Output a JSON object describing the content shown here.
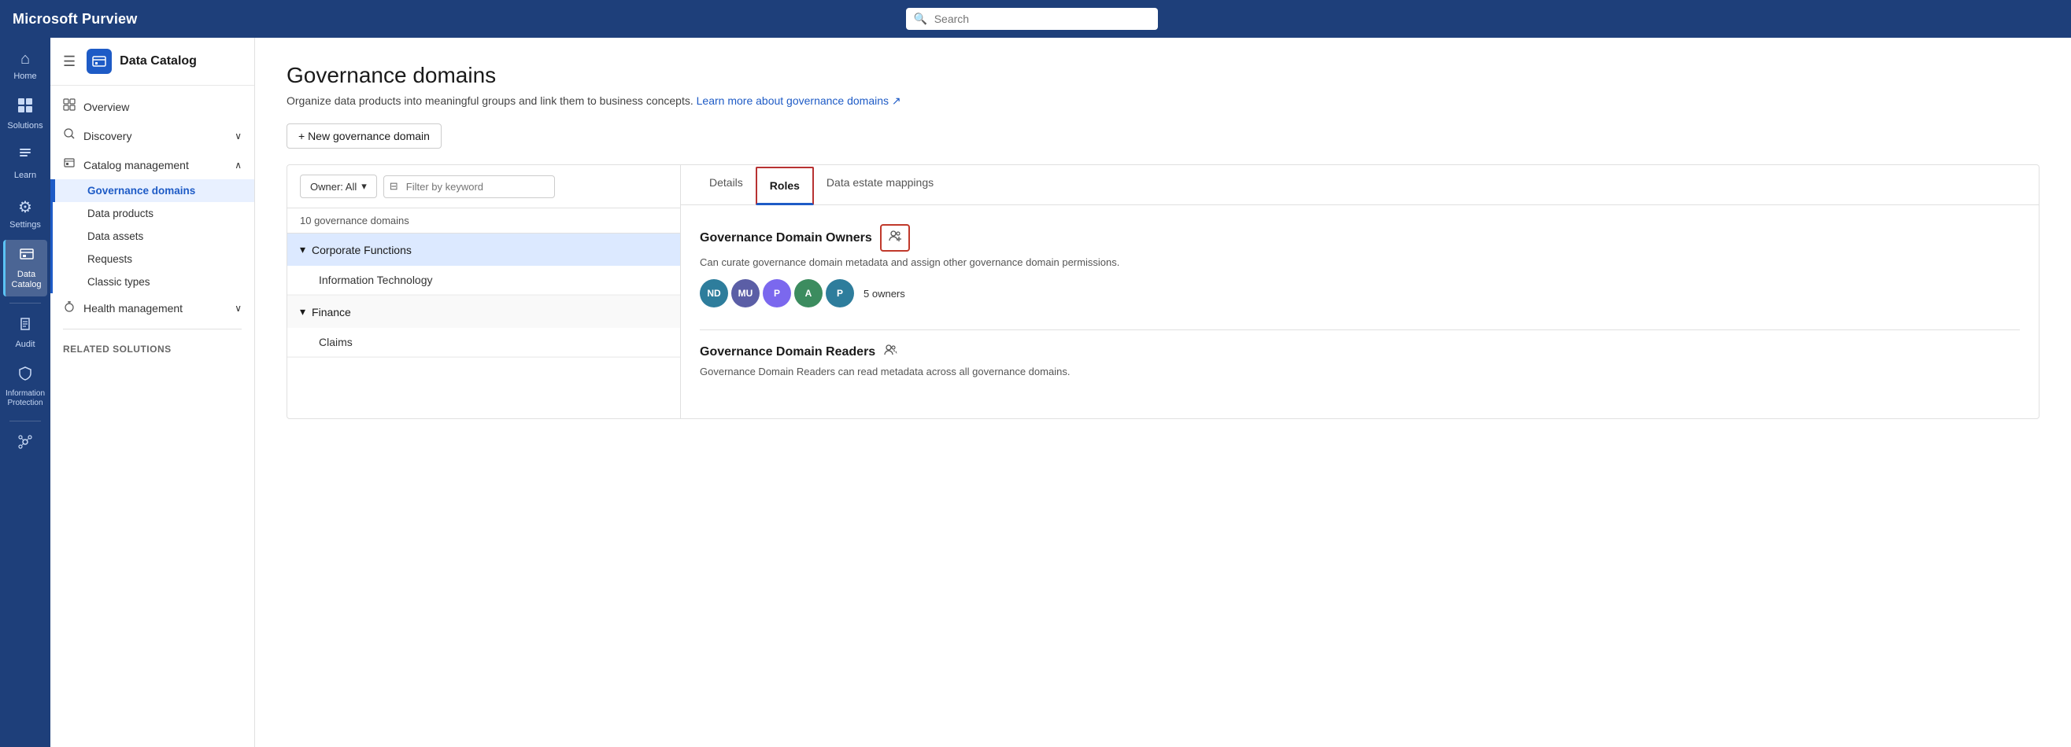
{
  "topbar": {
    "logo": "Microsoft Purview",
    "search_placeholder": "Search"
  },
  "icon_nav": {
    "items": [
      {
        "id": "home",
        "icon": "⌂",
        "label": "Home"
      },
      {
        "id": "solutions",
        "icon": "⊞",
        "label": "Solutions"
      },
      {
        "id": "learn",
        "icon": "📖",
        "label": "Learn"
      },
      {
        "id": "settings",
        "icon": "⚙",
        "label": "Settings"
      },
      {
        "id": "data-catalog",
        "icon": "🗄",
        "label": "Data Catalog",
        "active": true
      },
      {
        "id": "audit",
        "icon": "📋",
        "label": "Audit"
      },
      {
        "id": "info-protection",
        "icon": "🔒",
        "label": "Information Protection"
      }
    ]
  },
  "sidebar": {
    "header_title": "Data Catalog",
    "nav_items": [
      {
        "id": "overview",
        "label": "Overview",
        "icon": "⊞",
        "type": "item"
      },
      {
        "id": "discovery",
        "label": "Discovery",
        "icon": "🔍",
        "type": "expandable",
        "expanded": true
      },
      {
        "id": "catalog-management",
        "label": "Catalog management",
        "icon": "📁",
        "type": "expandable",
        "expanded": true
      },
      {
        "id": "governance-domains",
        "label": "Governance domains",
        "type": "subitem",
        "active": true
      },
      {
        "id": "data-products",
        "label": "Data products",
        "type": "subitem"
      },
      {
        "id": "data-assets",
        "label": "Data assets",
        "type": "subitem"
      },
      {
        "id": "requests",
        "label": "Requests",
        "type": "subitem"
      },
      {
        "id": "classic-types",
        "label": "Classic types",
        "type": "subitem"
      },
      {
        "id": "health-management",
        "label": "Health management",
        "icon": "💊",
        "type": "expandable"
      }
    ],
    "related_label": "Related solutions"
  },
  "page": {
    "title": "Governance domains",
    "subtitle": "Organize data products into meaningful groups and link them to business concepts.",
    "learn_link": "Learn more about governance domains ↗",
    "new_btn": "+ New governance domain"
  },
  "domain_list": {
    "owner_filter": "Owner: All",
    "filter_placeholder": "Filter by keyword",
    "filter_icon": "⊟",
    "count_label": "10 governance domains",
    "domains": [
      {
        "id": "corporate-functions",
        "label": "Corporate Functions",
        "expanded": true,
        "children": [
          {
            "id": "information-technology",
            "label": "Information Technology"
          }
        ]
      },
      {
        "id": "finance",
        "label": "Finance",
        "expanded": true,
        "children": [
          {
            "id": "claims",
            "label": "Claims"
          }
        ]
      }
    ]
  },
  "details_panel": {
    "tabs": [
      {
        "id": "details",
        "label": "Details"
      },
      {
        "id": "roles",
        "label": "Roles",
        "active": true
      },
      {
        "id": "data-estate-mappings",
        "label": "Data estate mappings"
      }
    ],
    "roles": {
      "owners": {
        "title": "Governance Domain Owners",
        "description": "Can curate governance domain metadata and assign other governance domain permissions.",
        "avatars": [
          {
            "initials": "ND",
            "color": "#2e7d9c"
          },
          {
            "initials": "MU",
            "color": "#5b5ea6"
          },
          {
            "initials": "P",
            "color": "#7b68ee"
          },
          {
            "initials": "A",
            "color": "#3c8c5f"
          },
          {
            "initials": "P",
            "color": "#2e7d9c"
          }
        ],
        "count": "5 owners"
      },
      "readers": {
        "title": "Governance Domain Readers",
        "description": "Governance Domain Readers can read metadata across all governance domains."
      }
    }
  }
}
